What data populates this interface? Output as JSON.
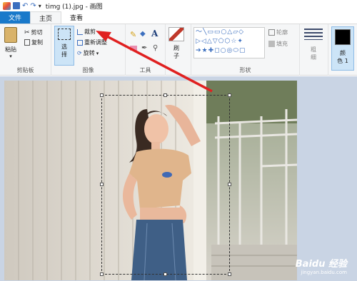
{
  "window": {
    "title": "timg (1).jpg - 画图"
  },
  "tabs": {
    "file": "文件",
    "home": "主页",
    "view": "查看"
  },
  "clipboard": {
    "paste": "粘贴",
    "cut": "剪切",
    "copy": "复制",
    "label": "剪贴板"
  },
  "image": {
    "select": "选",
    "select2": "择",
    "crop": "裁剪",
    "resize": "重新调整",
    "rotate": "旋转",
    "label": "图像"
  },
  "tools": {
    "label": "工具"
  },
  "brushes": {
    "label": "刷",
    "label2": "子"
  },
  "shapes": {
    "outline": "轮廓",
    "fill": "填充",
    "label": "形状"
  },
  "size": {
    "label": "粗",
    "label2": "细"
  },
  "colors": {
    "color1": "颜",
    "color1b": "色 1"
  },
  "watermark": {
    "brand": "Baidu 经验",
    "url": "jingyan.baidu.com"
  },
  "accent": "#1979ca",
  "arrow_color": "#e02020"
}
